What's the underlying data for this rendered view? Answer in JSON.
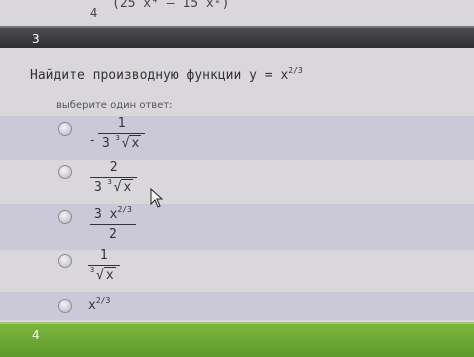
{
  "previous": {
    "denominator": "4",
    "expression": "(25 x⁴ – 15 x²)"
  },
  "question": {
    "number": "3",
    "text": "Найдите производную функции",
    "formula": "y = x",
    "exponent": "2/3",
    "hint": "выберите один ответ:"
  },
  "answers": [
    {
      "sign": "-",
      "numerator": "1",
      "coef": "3",
      "root_index": "3",
      "radicand": "x"
    },
    {
      "numerator": "2",
      "coef": "3",
      "root_index": "3",
      "radicand": "x"
    },
    {
      "numerator": "3 x",
      "numerator_exp": "2/3",
      "denominator": "2"
    },
    {
      "numerator": "1",
      "root_index": "3",
      "radicand": "x"
    },
    {
      "base": "x",
      "exponent": "2/3"
    }
  ],
  "next": {
    "number": "4"
  },
  "icons": {
    "cursor": "mouse-pointer-icon",
    "radio": "radio-button-icon"
  }
}
